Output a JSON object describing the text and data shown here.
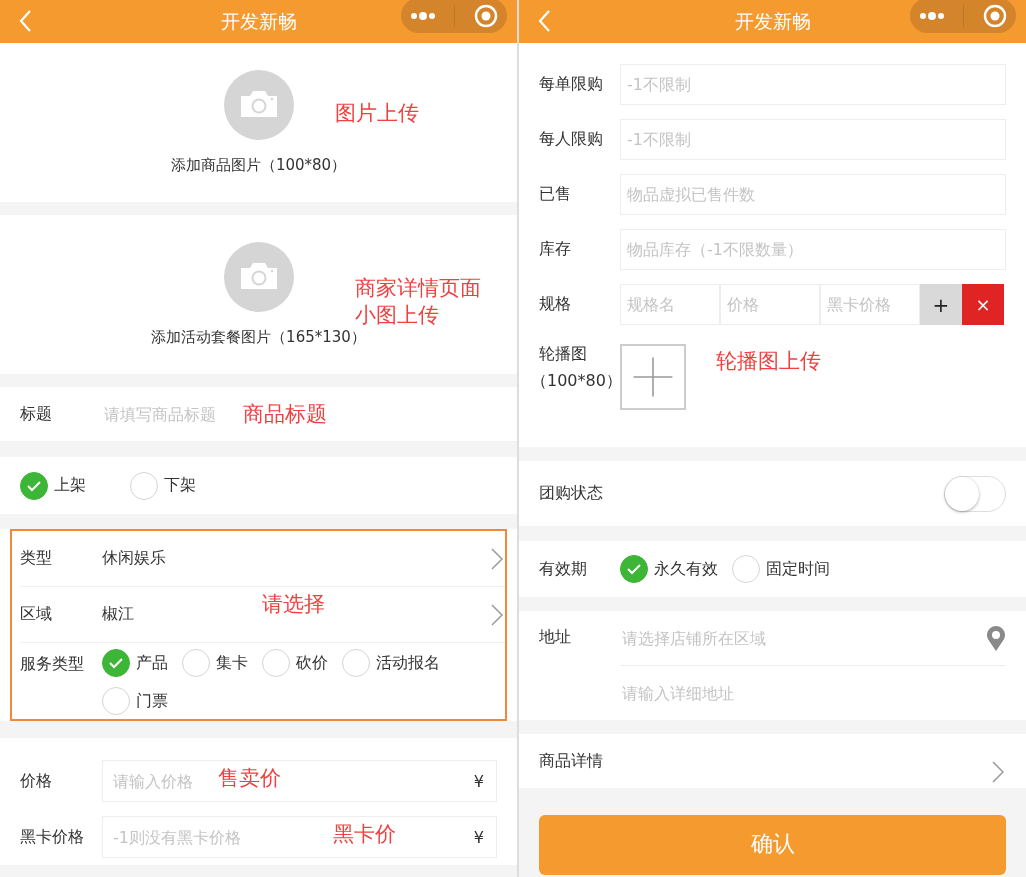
{
  "left_screen": {
    "header": {
      "title": "开发新畅"
    },
    "uploads": [
      {
        "label": "添加商品图片（100*80）",
        "annotation": "图片上传"
      },
      {
        "label": "添加活动套餐图片（165*130）",
        "annotation": "商家详情页面小图上传"
      }
    ],
    "title_field": {
      "label": "标题",
      "placeholder": "请填写商品标题",
      "annotation": "商品标题"
    },
    "shelf_options": [
      {
        "label": "上架",
        "selected": true
      },
      {
        "label": "下架",
        "selected": false
      }
    ],
    "category_box": {
      "highlighted": true,
      "annotation": "请选择",
      "rows": [
        {
          "label": "类型",
          "value": "休闲娱乐"
        },
        {
          "label": "区域",
          "value": "椒江"
        }
      ],
      "service": {
        "label": "服务类型",
        "options": [
          {
            "label": "产品",
            "selected": true
          },
          {
            "label": "集卡",
            "selected": false
          },
          {
            "label": "砍价",
            "selected": false
          },
          {
            "label": "活动报名",
            "selected": false
          },
          {
            "label": "门票",
            "selected": false
          }
        ]
      }
    },
    "price_fields": [
      {
        "label": "价格",
        "placeholder": "请输入价格",
        "unit": "¥",
        "annotation": "售卖价"
      },
      {
        "label": "黑卡价格",
        "placeholder": "-1则没有黑卡价格",
        "unit": "¥",
        "annotation": "黑卡价"
      }
    ]
  },
  "right_screen": {
    "header": {
      "title": "开发新畅"
    },
    "fields": [
      {
        "label": "每单限购",
        "placeholder": "-1不限制"
      },
      {
        "label": "每人限购",
        "placeholder": "-1不限制"
      },
      {
        "label": "已售",
        "placeholder": "物品虚拟已售件数"
      },
      {
        "label": "库存",
        "placeholder": "物品库存（-1不限数量）"
      }
    ],
    "spec": {
      "label": "规格",
      "placeholders": [
        "规格名",
        "价格",
        "黑卡价格"
      ],
      "add": "+",
      "remove": "×"
    },
    "carousel": {
      "label": "轮播图",
      "hint": "（100*80）",
      "annotation": "轮播图上传"
    },
    "group_buy": {
      "label": "团购状态",
      "on": false
    },
    "validity": {
      "label": "有效期",
      "options": [
        {
          "label": "永久有效",
          "selected": true
        },
        {
          "label": "固定时间",
          "selected": false
        }
      ]
    },
    "address": {
      "label": "地址",
      "placeholders": [
        "请选择店铺所在区域",
        "请输入详细地址"
      ]
    },
    "detail": {
      "label": "商品详情"
    },
    "confirm": "确认"
  }
}
